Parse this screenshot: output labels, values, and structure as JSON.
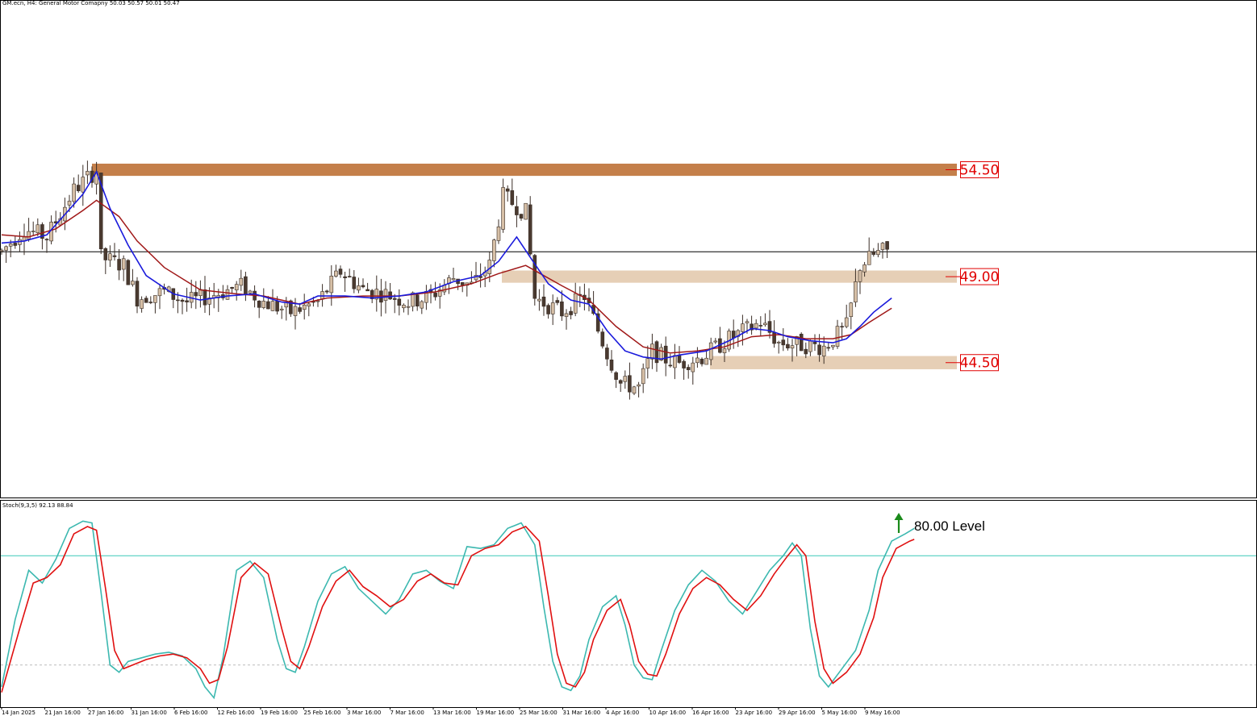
{
  "header": {
    "title": "GM.ecn, H4:  General Motor Comapny  50.03 50.57 50.01 50.47"
  },
  "stoch_header": {
    "title": "Stoch(9,3,5) 92.13 88.84"
  },
  "colors": {
    "up_fill": "#d6bfa6",
    "down_fill": "#4a3a30",
    "wick": "#3a2e26",
    "ma_fast": "#1a1adc",
    "ma_slow": "#a01818",
    "resistance_zone": "#c47f4a",
    "zone": "#e6cfb6",
    "stoch_main": "#3cb8b0",
    "stoch_signal": "#e01010",
    "level_line": "#3cc8b8",
    "price_label": "#e00000",
    "arrow": "#1a8a1a"
  },
  "chart_data": [
    {
      "type": "candlestick",
      "symbol": "GM.ecn",
      "timeframe": "H4",
      "ylim": [
        38.4,
        62.8
      ],
      "current_price": 50.47,
      "x_tick_labels": [
        "14 Jan 2025",
        "21 Jan 16:00",
        "27 Jan 16:00",
        "31 Jan 16:00",
        "6 Feb 16:00",
        "12 Feb 16:00",
        "19 Feb 16:00",
        "25 Feb 16:00",
        "3 Mar 16:00",
        "7 Mar 16:00",
        "13 Mar 16:00",
        "19 Mar 16:00",
        "25 Mar 16:00",
        "31 Mar 16:00",
        "4 Apr 16:00",
        "10 Apr 16:00",
        "16 Apr 16:00",
        "23 Apr 16:00",
        "29 Apr 16:00",
        "5 May 16:00",
        "9 May 16:00"
      ],
      "zones": [
        {
          "label": "54.50",
          "low": 54.2,
          "high": 54.8,
          "x_end_index": 197
        },
        {
          "label": "49.00",
          "low": 48.95,
          "high": 49.55,
          "x_end_index": 197
        },
        {
          "label": "44.50",
          "low": 44.7,
          "high": 45.35,
          "x_end_index": 197
        }
      ],
      "close_path": [
        [
          0,
          50.5
        ],
        [
          5,
          51.6
        ],
        [
          10,
          51.2
        ],
        [
          16,
          53.5
        ],
        [
          21,
          54.5
        ],
        [
          22,
          50.2
        ],
        [
          27,
          49.8
        ],
        [
          30,
          48.2
        ],
        [
          36,
          48.5
        ],
        [
          41,
          48.0
        ],
        [
          46,
          48.3
        ],
        [
          53,
          48.8
        ],
        [
          58,
          48.0
        ],
        [
          64,
          47.5
        ],
        [
          70,
          48.0
        ],
        [
          75,
          49.5
        ],
        [
          80,
          48.6
        ],
        [
          85,
          48.4
        ],
        [
          90,
          48.0
        ],
        [
          95,
          48.3
        ],
        [
          100,
          49.2
        ],
        [
          104,
          48.8
        ],
        [
          108,
          49.8
        ],
        [
          111,
          53.2
        ],
        [
          116,
          52.4
        ],
        [
          118,
          48.2
        ],
        [
          124,
          47.5
        ],
        [
          129,
          48.3
        ],
        [
          134,
          45.5
        ],
        [
          137,
          44.0
        ],
        [
          141,
          43.8
        ],
        [
          144,
          45.6
        ],
        [
          147,
          45.2
        ],
        [
          150,
          45.0
        ],
        [
          155,
          45.3
        ],
        [
          161,
          46.2
        ],
        [
          168,
          47.0
        ],
        [
          172,
          46.0
        ],
        [
          177,
          45.9
        ],
        [
          182,
          45.8
        ],
        [
          187,
          46.8
        ],
        [
          190,
          49.8
        ],
        [
          193,
          50.3
        ],
        [
          195,
          50.5
        ]
      ],
      "ma_fast_path": [
        [
          0,
          50.9
        ],
        [
          5,
          51.0
        ],
        [
          10,
          51.3
        ],
        [
          18,
          53.3
        ],
        [
          21,
          54.4
        ],
        [
          24,
          52.6
        ],
        [
          28,
          50.8
        ],
        [
          32,
          49.3
        ],
        [
          38,
          48.4
        ],
        [
          44,
          48.1
        ],
        [
          50,
          48.3
        ],
        [
          56,
          48.4
        ],
        [
          62,
          48.0
        ],
        [
          66,
          47.9
        ],
        [
          70,
          48.3
        ],
        [
          76,
          48.3
        ],
        [
          82,
          48.2
        ],
        [
          88,
          48.3
        ],
        [
          94,
          48.5
        ],
        [
          100,
          49.0
        ],
        [
          106,
          49.3
        ],
        [
          110,
          50.0
        ],
        [
          114,
          51.2
        ],
        [
          117,
          50.2
        ],
        [
          121,
          48.9
        ],
        [
          126,
          48.1
        ],
        [
          130,
          47.9
        ],
        [
          134,
          46.6
        ],
        [
          138,
          45.6
        ],
        [
          142,
          45.3
        ],
        [
          146,
          45.2
        ],
        [
          150,
          45.4
        ],
        [
          156,
          45.6
        ],
        [
          161,
          46.1
        ],
        [
          166,
          46.7
        ],
        [
          170,
          46.6
        ],
        [
          174,
          46.3
        ],
        [
          179,
          46.1
        ],
        [
          184,
          46.0
        ],
        [
          187,
          46.2
        ],
        [
          190,
          46.8
        ],
        [
          193,
          47.5
        ],
        [
          197,
          48.2
        ]
      ],
      "ma_slow_path": [
        [
          0,
          51.3
        ],
        [
          6,
          51.2
        ],
        [
          12,
          51.6
        ],
        [
          18,
          52.5
        ],
        [
          21,
          53.0
        ],
        [
          26,
          52.2
        ],
        [
          30,
          51.0
        ],
        [
          36,
          49.7
        ],
        [
          44,
          48.6
        ],
        [
          52,
          48.4
        ],
        [
          58,
          48.3
        ],
        [
          66,
          47.9
        ],
        [
          72,
          48.2
        ],
        [
          80,
          48.3
        ],
        [
          88,
          48.3
        ],
        [
          96,
          48.5
        ],
        [
          104,
          48.9
        ],
        [
          110,
          49.4
        ],
        [
          116,
          49.8
        ],
        [
          120,
          49.3
        ],
        [
          124,
          48.8
        ],
        [
          130,
          48.1
        ],
        [
          136,
          46.8
        ],
        [
          142,
          45.8
        ],
        [
          148,
          45.5
        ],
        [
          154,
          45.6
        ],
        [
          160,
          45.8
        ],
        [
          166,
          46.3
        ],
        [
          172,
          46.4
        ],
        [
          178,
          46.2
        ],
        [
          184,
          46.2
        ],
        [
          188,
          46.4
        ],
        [
          192,
          47.0
        ],
        [
          197,
          47.7
        ]
      ]
    },
    {
      "type": "line",
      "title": "Stoch(9,3,5)",
      "ylim": [
        0,
        100
      ],
      "levels": [
        80,
        20
      ],
      "level_annotation": "80.00 Level",
      "series": [
        {
          "name": "92.13",
          "points": [
            [
              0,
              8
            ],
            [
              3,
              45
            ],
            [
              6,
              72
            ],
            [
              9,
              65
            ],
            [
              12,
              78
            ],
            [
              15,
              95
            ],
            [
              18,
              99
            ],
            [
              20,
              98
            ],
            [
              22,
              60
            ],
            [
              24,
              20
            ],
            [
              26,
              16
            ],
            [
              28,
              22
            ],
            [
              31,
              24
            ],
            [
              34,
              26
            ],
            [
              37,
              27
            ],
            [
              40,
              25
            ],
            [
              43,
              18
            ],
            [
              45,
              8
            ],
            [
              47,
              2
            ],
            [
              49,
              24
            ],
            [
              52,
              72
            ],
            [
              55,
              77
            ],
            [
              58,
              68
            ],
            [
              61,
              34
            ],
            [
              63,
              18
            ],
            [
              65,
              16
            ],
            [
              67,
              30
            ],
            [
              70,
              55
            ],
            [
              73,
              70
            ],
            [
              76,
              74
            ],
            [
              79,
              62
            ],
            [
              82,
              55
            ],
            [
              85,
              48
            ],
            [
              88,
              56
            ],
            [
              91,
              70
            ],
            [
              94,
              72
            ],
            [
              97,
              66
            ],
            [
              100,
              62
            ],
            [
              103,
              85
            ],
            [
              106,
              84
            ],
            [
              109,
              86
            ],
            [
              112,
              95
            ],
            [
              115,
              98
            ],
            [
              118,
              86
            ],
            [
              120,
              52
            ],
            [
              122,
              22
            ],
            [
              124,
              8
            ],
            [
              126,
              6
            ],
            [
              128,
              14
            ],
            [
              130,
              34
            ],
            [
              133,
              52
            ],
            [
              136,
              58
            ],
            [
              138,
              42
            ],
            [
              140,
              20
            ],
            [
              142,
              13
            ],
            [
              144,
              12
            ],
            [
              146,
              28
            ],
            [
              149,
              50
            ],
            [
              152,
              64
            ],
            [
              155,
              72
            ],
            [
              158,
              66
            ],
            [
              161,
              55
            ],
            [
              164,
              48
            ],
            [
              167,
              60
            ],
            [
              170,
              72
            ],
            [
              173,
              80
            ],
            [
              175,
              87
            ],
            [
              177,
              80
            ],
            [
              179,
              40
            ],
            [
              181,
              14
            ],
            [
              183,
              8
            ],
            [
              186,
              18
            ],
            [
              189,
              28
            ],
            [
              192,
              50
            ],
            [
              194,
              72
            ],
            [
              197,
              88
            ],
            [
              200,
              92
            ],
            [
              202,
              95
            ]
          ]
        },
        {
          "name": "88.84",
          "points": [
            [
              0,
              5
            ],
            [
              4,
              40
            ],
            [
              7,
              65
            ],
            [
              10,
              68
            ],
            [
              13,
              75
            ],
            [
              16,
              92
            ],
            [
              19,
              96
            ],
            [
              21,
              94
            ],
            [
              23,
              62
            ],
            [
              25,
              28
            ],
            [
              27,
              18
            ],
            [
              29,
              20
            ],
            [
              32,
              23
            ],
            [
              35,
              25
            ],
            [
              38,
              26
            ],
            [
              41,
              24
            ],
            [
              44,
              18
            ],
            [
              46,
              10
            ],
            [
              48,
              12
            ],
            [
              50,
              30
            ],
            [
              53,
              68
            ],
            [
              56,
              76
            ],
            [
              59,
              70
            ],
            [
              62,
              40
            ],
            [
              64,
              22
            ],
            [
              66,
              18
            ],
            [
              68,
              30
            ],
            [
              71,
              52
            ],
            [
              74,
              66
            ],
            [
              77,
              72
            ],
            [
              80,
              63
            ],
            [
              83,
              58
            ],
            [
              86,
              52
            ],
            [
              89,
              56
            ],
            [
              92,
              66
            ],
            [
              95,
              70
            ],
            [
              98,
              65
            ],
            [
              101,
              64
            ],
            [
              104,
              80
            ],
            [
              107,
              84
            ],
            [
              110,
              86
            ],
            [
              113,
              93
            ],
            [
              116,
              96
            ],
            [
              119,
              88
            ],
            [
              121,
              58
            ],
            [
              123,
              26
            ],
            [
              125,
              10
            ],
            [
              127,
              8
            ],
            [
              129,
              16
            ],
            [
              131,
              34
            ],
            [
              134,
              50
            ],
            [
              137,
              56
            ],
            [
              139,
              42
            ],
            [
              141,
              22
            ],
            [
              143,
              15
            ],
            [
              145,
              14
            ],
            [
              147,
              26
            ],
            [
              150,
              48
            ],
            [
              153,
              62
            ],
            [
              156,
              68
            ],
            [
              159,
              64
            ],
            [
              162,
              56
            ],
            [
              165,
              50
            ],
            [
              168,
              58
            ],
            [
              171,
              70
            ],
            [
              174,
              80
            ],
            [
              176,
              86
            ],
            [
              178,
              80
            ],
            [
              180,
              44
            ],
            [
              182,
              18
            ],
            [
              184,
              10
            ],
            [
              187,
              16
            ],
            [
              190,
              26
            ],
            [
              193,
              46
            ],
            [
              195,
              68
            ],
            [
              198,
              84
            ],
            [
              201,
              88
            ],
            [
              202,
              89
            ]
          ]
        }
      ]
    }
  ]
}
